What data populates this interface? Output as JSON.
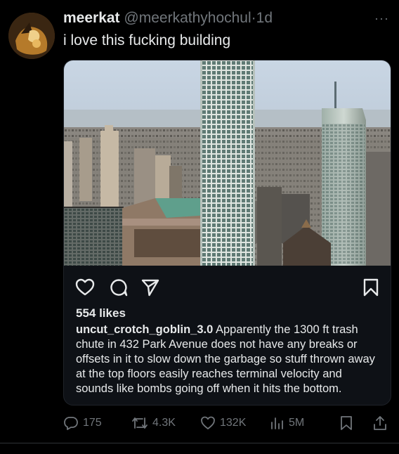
{
  "tweet": {
    "display_name": "meerkat",
    "handle": "@meerkathyhochul",
    "separator": "·",
    "time": "1d",
    "text": "i love this fucking building",
    "more_icon": "ellipsis-icon"
  },
  "embedded_post": {
    "image_description_icon": "photo",
    "likes": "554 likes",
    "caption_user": "uncut_crotch_goblin_3.0",
    "caption_text": " Apparently the 1300 ft trash chute in 432 Park Avenue does not have any breaks or offsets in it to slow down the garbage so stuff thrown away at the top floors easily reaches terminal velocity and sounds like bombs going off when it hits the bottom."
  },
  "stats": {
    "replies": "175",
    "reposts": "4.3K",
    "likes": "132K",
    "views": "5M"
  }
}
